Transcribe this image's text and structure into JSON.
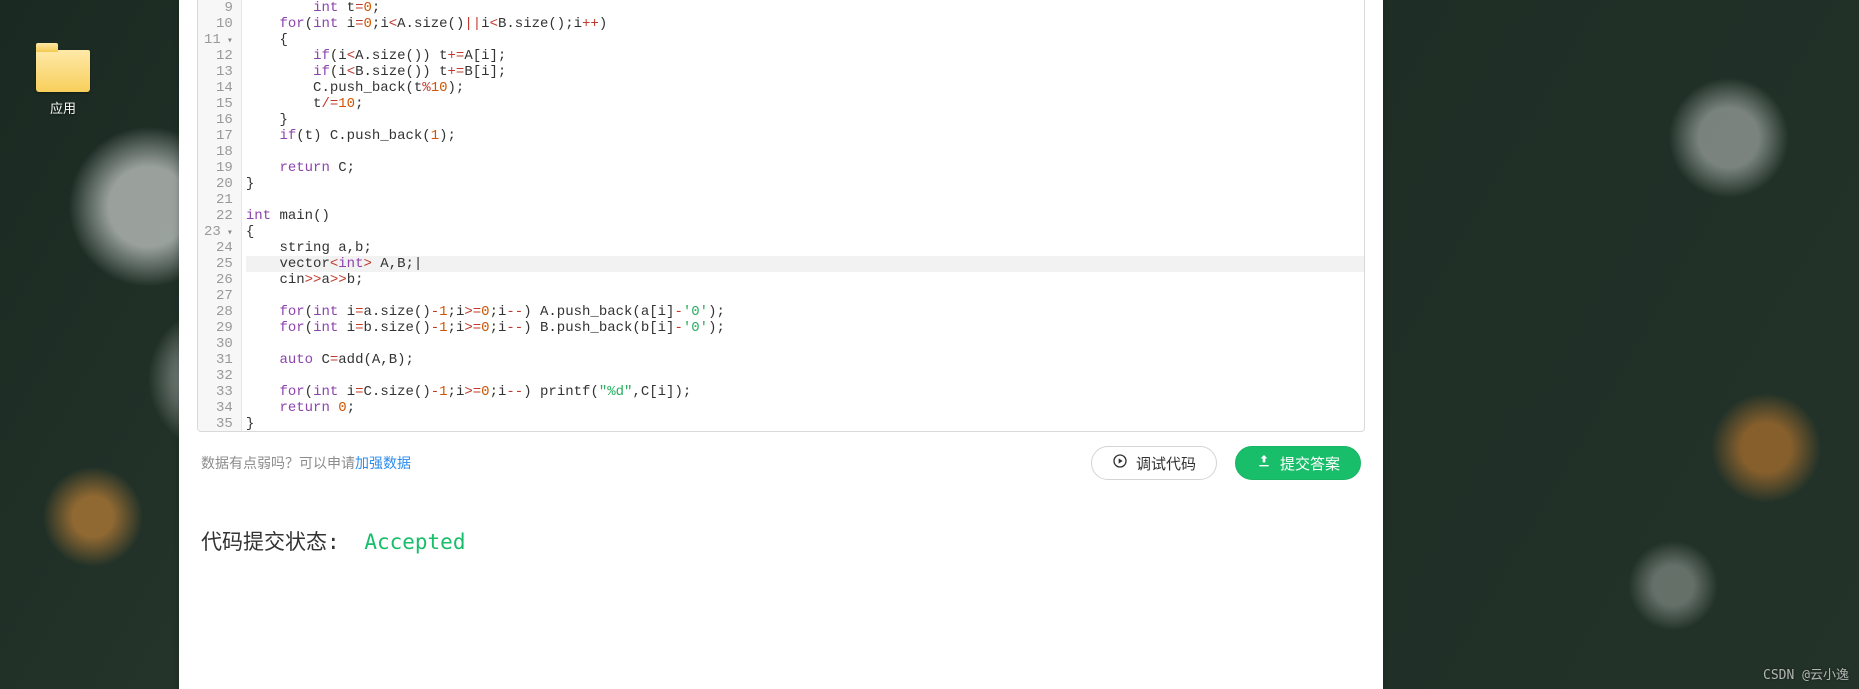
{
  "desktop": {
    "folder_label": "应用"
  },
  "editor": {
    "lines": [
      {
        "n": 9,
        "fold": false,
        "hl": false,
        "html": "        <span class='kw'>int</span> t<span class='op'>=</span><span class='num'>0</span>;"
      },
      {
        "n": 10,
        "fold": false,
        "hl": false,
        "html": "    <span class='kw'>for</span>(<span class='kw'>int</span> i<span class='op'>=</span><span class='num'>0</span>;i<span class='op'>&lt;</span>A.size()<span class='op'>||</span>i<span class='op'>&lt;</span>B.size();i<span class='op'>++</span>)"
      },
      {
        "n": 11,
        "fold": true,
        "hl": false,
        "html": "    {"
      },
      {
        "n": 12,
        "fold": false,
        "hl": false,
        "html": "        <span class='kw'>if</span>(i<span class='op'>&lt;</span>A.size()) t<span class='op'>+=</span>A[i];"
      },
      {
        "n": 13,
        "fold": false,
        "hl": false,
        "html": "        <span class='kw'>if</span>(i<span class='op'>&lt;</span>B.size()) t<span class='op'>+=</span>B[i];"
      },
      {
        "n": 14,
        "fold": false,
        "hl": false,
        "html": "        C.push_back(t<span class='op'>%</span><span class='num'>10</span>);"
      },
      {
        "n": 15,
        "fold": false,
        "hl": false,
        "html": "        t<span class='op'>/=</span><span class='num'>10</span>;"
      },
      {
        "n": 16,
        "fold": false,
        "hl": false,
        "html": "    }"
      },
      {
        "n": 17,
        "fold": false,
        "hl": false,
        "html": "    <span class='kw'>if</span>(t) C.push_back(<span class='num'>1</span>);"
      },
      {
        "n": 18,
        "fold": false,
        "hl": false,
        "html": ""
      },
      {
        "n": 19,
        "fold": false,
        "hl": false,
        "html": "    <span class='kw'>return</span> C;"
      },
      {
        "n": 20,
        "fold": false,
        "hl": false,
        "html": "}"
      },
      {
        "n": 21,
        "fold": false,
        "hl": false,
        "html": ""
      },
      {
        "n": 22,
        "fold": false,
        "hl": false,
        "html": "<span class='kw'>int</span> main()"
      },
      {
        "n": 23,
        "fold": true,
        "hl": false,
        "html": "{"
      },
      {
        "n": 24,
        "fold": false,
        "hl": false,
        "html": "    string a,b;"
      },
      {
        "n": 25,
        "fold": false,
        "hl": true,
        "html": "    vector<span class='op'>&lt;</span><span class='kw'>int</span><span class='op'>&gt;</span> A,B;|"
      },
      {
        "n": 26,
        "fold": false,
        "hl": false,
        "html": "    cin<span class='op'>&gt;&gt;</span>a<span class='op'>&gt;&gt;</span>b;"
      },
      {
        "n": 27,
        "fold": false,
        "hl": false,
        "html": ""
      },
      {
        "n": 28,
        "fold": false,
        "hl": false,
        "html": "    <span class='kw'>for</span>(<span class='kw'>int</span> i<span class='op'>=</span>a.size()<span class='op'>-</span><span class='num'>1</span>;i<span class='op'>&gt;=</span><span class='num'>0</span>;i<span class='op'>--</span>) A.push_back(a[i]<span class='op'>-</span><span class='str'>'0'</span>);"
      },
      {
        "n": 29,
        "fold": false,
        "hl": false,
        "html": "    <span class='kw'>for</span>(<span class='kw'>int</span> i<span class='op'>=</span>b.size()<span class='op'>-</span><span class='num'>1</span>;i<span class='op'>&gt;=</span><span class='num'>0</span>;i<span class='op'>--</span>) B.push_back(b[i]<span class='op'>-</span><span class='str'>'0'</span>);"
      },
      {
        "n": 30,
        "fold": false,
        "hl": false,
        "html": ""
      },
      {
        "n": 31,
        "fold": false,
        "hl": false,
        "html": "    <span class='kw'>auto</span> C<span class='op'>=</span>add(A,B);"
      },
      {
        "n": 32,
        "fold": false,
        "hl": false,
        "html": ""
      },
      {
        "n": 33,
        "fold": false,
        "hl": false,
        "html": "    <span class='kw'>for</span>(<span class='kw'>int</span> i<span class='op'>=</span>C.size()<span class='op'>-</span><span class='num'>1</span>;i<span class='op'>&gt;=</span><span class='num'>0</span>;i<span class='op'>--</span>) <span class='fn'>printf</span>(<span class='str'>\"%d\"</span>,C[i]);"
      },
      {
        "n": 34,
        "fold": false,
        "hl": false,
        "html": "    <span class='kw'>return</span> <span class='num'>0</span>;"
      },
      {
        "n": 35,
        "fold": false,
        "hl": false,
        "html": "}"
      }
    ]
  },
  "footer": {
    "weak_prefix": "数据有点弱吗？可以申请",
    "weak_link": "加强数据",
    "debug_label": "调试代码",
    "submit_label": "提交答案"
  },
  "status": {
    "label": "代码提交状态:",
    "value": "Accepted"
  },
  "watermark": "CSDN @云小逸"
}
